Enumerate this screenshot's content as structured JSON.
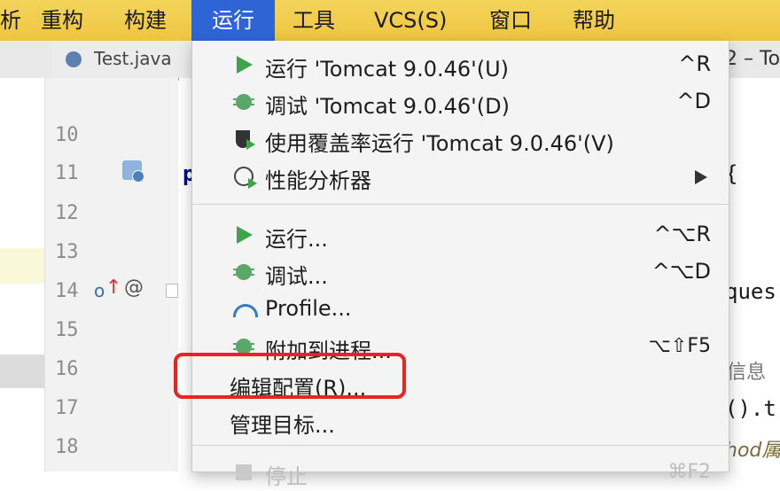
{
  "menubar": {
    "items": [
      {
        "label": "析"
      },
      {
        "label": "重构"
      },
      {
        "label": "构建"
      },
      {
        "label": "运行"
      },
      {
        "label": "工具"
      },
      {
        "label": "VCS(S)"
      },
      {
        "label": "窗口"
      },
      {
        "label": "帮助"
      }
    ],
    "active_index": 3,
    "accent_color": "#2f64d6",
    "bar_color": "#f0ca47"
  },
  "tabs": {
    "active_tab": "Test.java",
    "right_title": "2 – To"
  },
  "gutter": {
    "line_numbers": [
      "10",
      "11",
      "12",
      "13",
      "14",
      "15",
      "16",
      "17",
      "18"
    ],
    "at_symbol": "@",
    "icons": [
      "web-servlet-icon",
      "override-marker-icon"
    ]
  },
  "editor": {
    "line11_prefix": "p",
    "line11_brace": "{",
    "line14_tail": "ques",
    "line16_comment": "信息",
    "line17_tail": "().t",
    "line18_tail": "hod属"
  },
  "run_menu": {
    "items": [
      {
        "label": "运行 'Tomcat 9.0.46'(U)",
        "shortcut": "^R",
        "icon": "play-icon"
      },
      {
        "label": "调试 'Tomcat 9.0.46'(D)",
        "shortcut": "^D",
        "icon": "debug-icon"
      },
      {
        "label": "使用覆盖率运行  'Tomcat 9.0.46'(V)",
        "shortcut": "",
        "icon": "coverage-icon"
      },
      {
        "label": "性能分析器",
        "shortcut": "",
        "icon": "profiler-icon",
        "submenu": true
      },
      {
        "label": "运行...",
        "shortcut": "^⌥R",
        "icon": "play-icon"
      },
      {
        "label": "调试...",
        "shortcut": "^⌥D",
        "icon": "debug-icon"
      },
      {
        "label": "Profile...",
        "shortcut": "",
        "icon": "profile-gauge-icon"
      },
      {
        "label": "附加到进程...",
        "shortcut": "⌥⇧F5",
        "icon": "attach-debug-icon"
      },
      {
        "label": "编辑配置(R)...",
        "shortcut": "",
        "icon": ""
      },
      {
        "label": "管理目标...",
        "shortcut": "",
        "icon": ""
      },
      {
        "label": "停止",
        "shortcut": "⌘F2",
        "icon": "stop-icon",
        "disabled": true
      }
    ],
    "highlighted_item": "编辑配置(R)...",
    "highlight_color": "#ee2020"
  }
}
